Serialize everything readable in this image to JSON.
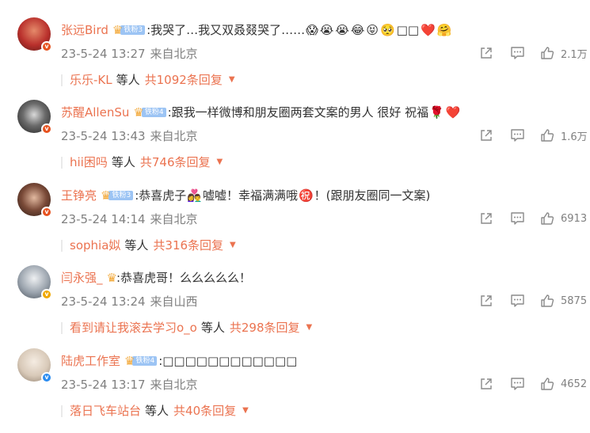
{
  "comments": [
    {
      "username": "张远Bird",
      "fan_badge": "铁粉3",
      "text": ":我哭了…我又双叒叕哭了……",
      "emojis": [
        "😱",
        "😭",
        "😭",
        "😂",
        "😝",
        "🥺",
        "□□",
        "❤️",
        "🤗"
      ],
      "time": "23-5-24 13:27",
      "location": "来自北京",
      "likes": "2.1万",
      "reply_user": "乐乐-KL",
      "reply_suffix": "等人",
      "reply_total": "共1092条回复",
      "avatar_color": "#b9302c",
      "badge_color": "#e6521f",
      "badge_icon": "v"
    },
    {
      "username": "苏醒AllenSu",
      "fan_badge": "铁粉4",
      "text": ":跟我一样微博和朋友圈两套文案的男人 很好 祝福",
      "emojis": [
        "🌹",
        "❤️"
      ],
      "time": "23-5-24 13:43",
      "location": "来自北京",
      "likes": "1.6万",
      "reply_user": "hii困吗",
      "reply_suffix": "等人",
      "reply_total": "共746条回复",
      "avatar_color": "#3a3a3a",
      "badge_color": "#e6521f",
      "badge_icon": "v"
    },
    {
      "username": "王铮亮",
      "fan_badge": "铁粉3",
      "text_before": ":恭喜虎子",
      "emojis_mid": [
        "👩‍❤️‍👨"
      ],
      "text_after": "嘘嘘！幸福满满哦",
      "emoji_after": "㊗️",
      "text_end": "！(跟朋友圈同一文案)",
      "time": "23-5-24 14:14",
      "location": "来自北京",
      "likes": "6913",
      "reply_user": "sophia姒",
      "reply_suffix": "等人",
      "reply_total": "共316条回复",
      "avatar_color": "#7a4a38",
      "badge_color": "#e6521f",
      "badge_icon": "v"
    },
    {
      "username": "闫永强_",
      "fan_badge": "",
      "text": ":恭喜虎哥！么么么么么！",
      "emojis": [],
      "time": "23-5-24 13:24",
      "location": "来自山西",
      "likes": "5875",
      "reply_user": "看到请让我滚去学习o_o",
      "reply_suffix": "等人",
      "reply_total": "共298条回复",
      "avatar_color": "#9aa3ad",
      "badge_color": "#f0a800",
      "badge_icon": "v"
    },
    {
      "username": "陆虎工作室",
      "fan_badge": "铁粉4",
      "text": ":□□□□□□□□□□□□",
      "emojis": [],
      "time": "23-5-24 13:17",
      "location": "来自北京",
      "likes": "4652",
      "reply_user": "落日飞车站台",
      "reply_suffix": "等人",
      "reply_total": "共40条回复",
      "avatar_color": "#d8c9b8",
      "badge_color": "#2a8cf0",
      "badge_icon": "v"
    }
  ],
  "icons": {
    "share": "share-icon",
    "comment": "comment-icon",
    "like": "like-icon",
    "expand": "caret-down-icon"
  },
  "colors": {
    "accent": "#eb7350",
    "meta": "#808080",
    "fan_tag": "#9cc4f4"
  }
}
